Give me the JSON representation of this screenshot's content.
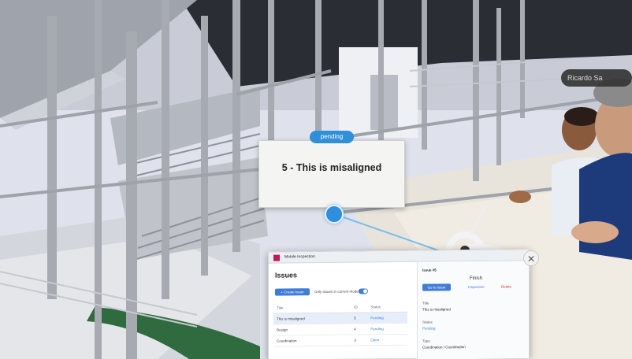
{
  "scene": {
    "avatar_tag": "Ricardo Sa",
    "bg_colors": {
      "sky": "#e9ecf5",
      "floor": "#e8e3da",
      "steel": "#a9acb3",
      "green": "#2f6b3f",
      "accent": "#2e8ee0"
    }
  },
  "issue_card": {
    "status": "pending",
    "title": "5 - This is misaligned"
  },
  "panel": {
    "app_name": "Mobile Inspection",
    "title": "Issues",
    "create_button": "+ Create Issue",
    "filter_label": "Only issues in current model",
    "table": {
      "headers": [
        "Title",
        "ID",
        "Status"
      ],
      "rows": [
        {
          "title": "This is misaligned",
          "id": "5",
          "status": "Pending"
        },
        {
          "title": "Design",
          "id": "4",
          "status": "Pending"
        },
        {
          "title": "Coordination",
          "id": "3",
          "status": "Open"
        }
      ]
    },
    "detail": {
      "header": "Issue #5",
      "finish_label": "Finish",
      "go_to_issue": "Go to Issue",
      "inspection": "Inspection",
      "delete": "Delete",
      "title_label": "Title",
      "title_value": "This is misaligned",
      "status_label": "Status",
      "status_value": "Pending",
      "type_label": "Type",
      "type_value": "Coordination / Coordination"
    },
    "close_symbol": "✕"
  }
}
